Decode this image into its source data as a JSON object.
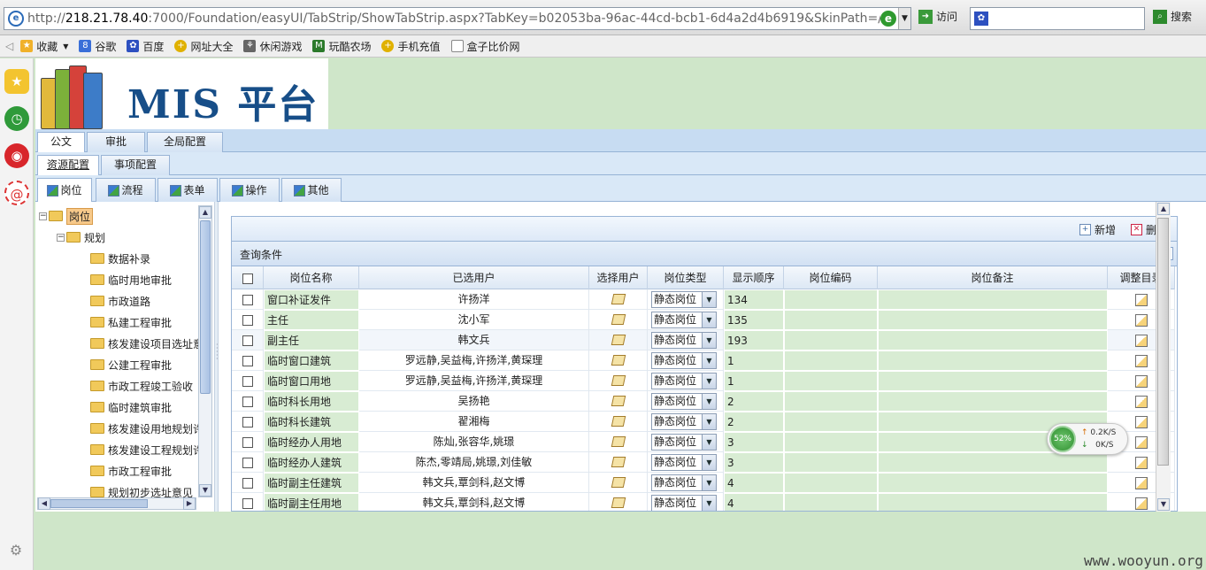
{
  "browser": {
    "url_prefix": "http://",
    "url_host": "218.21.78.40",
    "url_rest": ":7000/Foundation/easyUI/TabStrip/ShowTabStrip.aspx?TabKey=b02053ba-96ac-44cd-bcb1-6d4a2d4b6919&SkinPath=/Founc",
    "go_label": "访问",
    "search_label": "搜索",
    "search_value": "",
    "favorites_label": "收藏",
    "favorites": [
      "谷歌",
      "百度",
      "网址大全",
      "休闲游戏",
      "玩酷农场",
      "手机充值",
      "盒子比价网"
    ]
  },
  "logo": {
    "text": "MIS 平台"
  },
  "tabs": {
    "level1": [
      {
        "label": "公文",
        "active": true
      },
      {
        "label": "审批",
        "active": false
      },
      {
        "label": "全局配置",
        "active": false
      }
    ],
    "level2": [
      {
        "label": "资源配置",
        "active": true
      },
      {
        "label": "事项配置",
        "active": false
      }
    ],
    "level3": [
      {
        "label": "岗位",
        "active": true
      },
      {
        "label": "流程",
        "active": false
      },
      {
        "label": "表单",
        "active": false
      },
      {
        "label": "操作",
        "active": false
      },
      {
        "label": "其他",
        "active": false
      }
    ]
  },
  "tree": {
    "root": "岗位",
    "group": "规划",
    "items": [
      "数据补录",
      "临时用地审批",
      "市政道路",
      "私建工程审批",
      "核发建设项目选址意",
      "公建工程审批",
      "市政工程竣工验收",
      "临时建筑审批",
      "核发建设用地规划许",
      "核发建设工程规划许",
      "市政工程审批",
      "规划初步选址意见"
    ]
  },
  "toolbar": {
    "add_label": "新增",
    "delete_label": "删除"
  },
  "query": {
    "title": "查询条件"
  },
  "grid": {
    "columns": [
      "岗位名称",
      "已选用户",
      "选择用户",
      "岗位类型",
      "显示顺序",
      "岗位编码",
      "岗位备注",
      "调整目录"
    ],
    "rows": [
      {
        "name": "窗口补证发件",
        "users": "许扬洋",
        "type": "静态岗位",
        "order": "134"
      },
      {
        "name": "主任",
        "users": "沈小军",
        "type": "静态岗位",
        "order": "135"
      },
      {
        "name": "副主任",
        "users": "韩文兵",
        "type": "静态岗位",
        "order": "193"
      },
      {
        "name": "临时窗口建筑",
        "users": "罗远静,吴益梅,许扬洋,黄琛理",
        "type": "静态岗位",
        "order": "1"
      },
      {
        "name": "临时窗口用地",
        "users": "罗远静,吴益梅,许扬洋,黄琛理",
        "type": "静态岗位",
        "order": "1"
      },
      {
        "name": "临时科长用地",
        "users": "吴扬艳",
        "type": "静态岗位",
        "order": "2"
      },
      {
        "name": "临时科长建筑",
        "users": "翟湘梅",
        "type": "静态岗位",
        "order": "2"
      },
      {
        "name": "临时经办人用地",
        "users": "陈灿,张容华,姚璟",
        "type": "静态岗位",
        "order": "3"
      },
      {
        "name": "临时经办人建筑",
        "users": "陈杰,零靖局,姚璟,刘佳敏",
        "type": "静态岗位",
        "order": "3"
      },
      {
        "name": "临时副主任建筑",
        "users": "韩文兵,覃剑科,赵文博",
        "type": "静态岗位",
        "order": "4"
      },
      {
        "name": "临时副主任用地",
        "users": "韩文兵,覃剑科,赵文博",
        "type": "静态岗位",
        "order": "4"
      }
    ]
  },
  "net_widget": {
    "percent": "52%",
    "up": "0.2K/S",
    "down": "0K/S"
  },
  "watermark": "www.wooyun.org"
}
